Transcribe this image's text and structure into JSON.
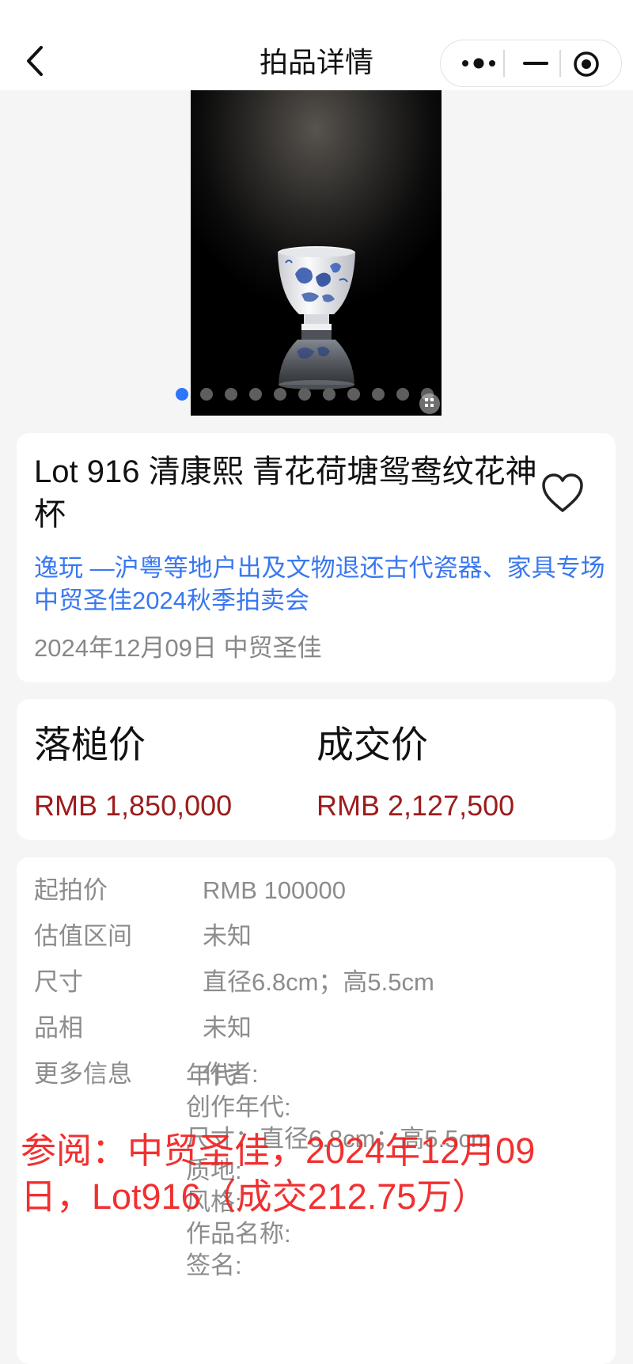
{
  "nav": {
    "title": "拍品详情"
  },
  "gallery": {
    "total_images": 11,
    "active_index": 0
  },
  "lot": {
    "title": "Lot 916 清康熙 青花荷塘鸳鸯纹花神杯",
    "session": "逸玩 —沪粤等地户出及文物退还古代瓷器、家具专场 中贸圣佳2024秋季拍卖会",
    "date_house": "2024年12月09日 中贸圣佳"
  },
  "prices": {
    "hammer_label": "落槌价",
    "hammer_value": "RMB 1,850,000",
    "deal_label": "成交价",
    "deal_value": "RMB 2,127,500"
  },
  "info": {
    "rows": [
      {
        "label": "起拍价",
        "value": "RMB 100000"
      },
      {
        "label": "估值区间",
        "value": "未知"
      },
      {
        "label": "尺寸",
        "value": "直径6.8cm；高5.5cm"
      },
      {
        "label": "品相",
        "value": "未知"
      },
      {
        "label": "更多信息",
        "value": "作者:"
      }
    ],
    "more": [
      "年代:",
      "创作年代:",
      "尺寸：直径6.8cm；高5.5cm",
      "质地:",
      "风格:",
      "作品名称:",
      "签名:"
    ]
  },
  "watermark": "参阅：中贸圣佳，2024年12月09日，Lot916（成交212.75万）",
  "colors": {
    "link": "#3a78f0",
    "price": "#9c1c1c",
    "watermark": "#f01e1e",
    "active_dot": "#2d74ff"
  }
}
